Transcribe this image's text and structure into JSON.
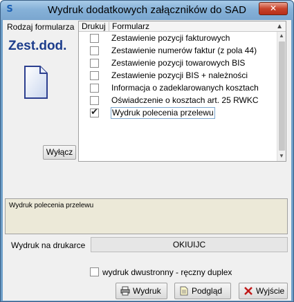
{
  "window": {
    "title": "Wydruk dodatkowych załączników do SAD",
    "close_label": "✕"
  },
  "left_panel": {
    "label": "Rodzaj formularza",
    "form_code": "Zest.dod.",
    "off_button": "Wyłącz"
  },
  "grid": {
    "col_print": "Drukuj",
    "col_form": "Formularz",
    "rows": [
      {
        "label": "Zestawienie pozycji fakturowych",
        "checked": false
      },
      {
        "label": "Zestawienie numerów faktur (z pola 44)",
        "checked": false
      },
      {
        "label": "Zestawienie pozycji towarowych BIS",
        "checked": false
      },
      {
        "label": "Zestawienie pozycji BIS + należności",
        "checked": false
      },
      {
        "label": "Informacja o zadeklarowanych kosztach",
        "checked": false
      },
      {
        "label": "Oświadczenie o kosztach art. 25 RWKC",
        "checked": false
      },
      {
        "label": "Wydruk polecenia przelewu",
        "checked": true
      }
    ]
  },
  "description": "Wydruk polecenia przelewu",
  "printer": {
    "label": "Wydruk na drukarce",
    "value": "OKIUIJC"
  },
  "duplex": {
    "label": "wydruk dwustronny - ręczny duplex",
    "checked": false
  },
  "buttons": {
    "print": "Wydruk",
    "preview": "Podgląd",
    "exit": "Wyjście"
  }
}
